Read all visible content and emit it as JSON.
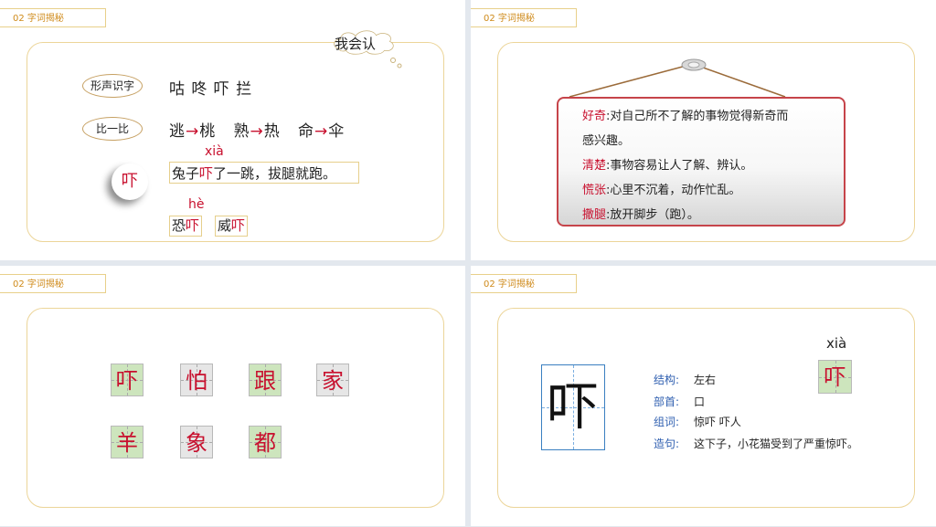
{
  "slides": [
    {
      "tag": "02 字词揭秘",
      "cloud_label": "我会认",
      "pill_1": "形声识字",
      "row_1": "咕 咚 吓 拦",
      "pill_2": "比一比",
      "row_2": [
        {
          "a": "逃",
          "b": "桃"
        },
        {
          "a": "熟",
          "b": "热"
        },
        {
          "a": "命",
          "b": "伞"
        }
      ],
      "arrow": "→",
      "focus_char": "吓",
      "pinyin_1": "xià",
      "sentence": {
        "pre": "兔子",
        "hl": "吓",
        "post": "了一跳，拔腿就跑。"
      },
      "pinyin_2": "hè",
      "words": [
        {
          "pre": "恐",
          "hl": "吓"
        },
        {
          "pre": "威",
          "hl": "吓"
        }
      ]
    },
    {
      "tag": "02 字词揭秘",
      "definitions": [
        {
          "term": "好奇",
          "text": ":对自己所不了解的事物觉得新奇而"
        },
        {
          "term": "",
          "text": "感兴趣。"
        },
        {
          "term": "清楚",
          "text": ":事物容易让人了解、辨认。"
        },
        {
          "term": "慌张",
          "text": ":心里不沉着，动作忙乱。"
        },
        {
          "term": "撒腿",
          "text": ":放开脚步（跑）。"
        }
      ]
    },
    {
      "tag": "02 字词揭秘",
      "chars": [
        "吓",
        "怕",
        "跟",
        "家",
        "羊",
        "象",
        "都"
      ]
    },
    {
      "tag": "02 字词揭秘",
      "char": "吓",
      "pinyin": "xià",
      "small_char": "吓",
      "rows": [
        {
          "k": "结构:",
          "v": "左右"
        },
        {
          "k": "部首:",
          "v": "口"
        },
        {
          "k": "组词:",
          "v": "惊吓  吓人"
        },
        {
          "k": "造句:",
          "v": "这下子，小花猫受到了严重惊吓。"
        }
      ]
    }
  ],
  "colors": {
    "accent_red": "#c8102e",
    "frame_gold": "#ecd599",
    "grid_green": "#cde5bd",
    "label_blue": "#2f5fb0"
  }
}
